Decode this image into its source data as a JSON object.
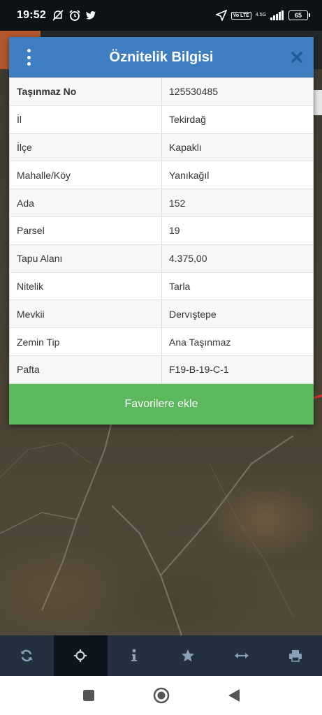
{
  "status_bar": {
    "time": "19:52",
    "network": "4.5G",
    "volte": "Vo LTE",
    "battery": "65"
  },
  "dialog": {
    "title": "Öznitelik Bilgisi",
    "rows": [
      {
        "key": "Taşınmaz No",
        "value": "125530485"
      },
      {
        "key": "İl",
        "value": "Tekirdağ"
      },
      {
        "key": "İlçe",
        "value": "Kapaklı"
      },
      {
        "key": "Mahalle/Köy",
        "value": "Yanıkağıl"
      },
      {
        "key": "Ada",
        "value": "152"
      },
      {
        "key": "Parsel",
        "value": "19"
      },
      {
        "key": "Tapu Alanı",
        "value": "4.375,00"
      },
      {
        "key": "Nitelik",
        "value": "Tarla"
      },
      {
        "key": "Mevkii",
        "value": "Dervıştepe"
      },
      {
        "key": "Zemin Tip",
        "value": "Ana Taşınmaz"
      },
      {
        "key": "Pafta",
        "value": "F19-B-19-C-1"
      }
    ],
    "favorite_label": "Favorilere ekle"
  },
  "toolbar": {
    "items": [
      {
        "icon": "refresh-icon"
      },
      {
        "icon": "locate-icon",
        "active": true
      },
      {
        "icon": "info-icon"
      },
      {
        "icon": "star-icon"
      },
      {
        "icon": "measure-icon"
      },
      {
        "icon": "print-icon"
      }
    ]
  },
  "colors": {
    "header": "#3d7fc1",
    "favorite": "#5cb85c",
    "toolbar": "#23313f"
  }
}
